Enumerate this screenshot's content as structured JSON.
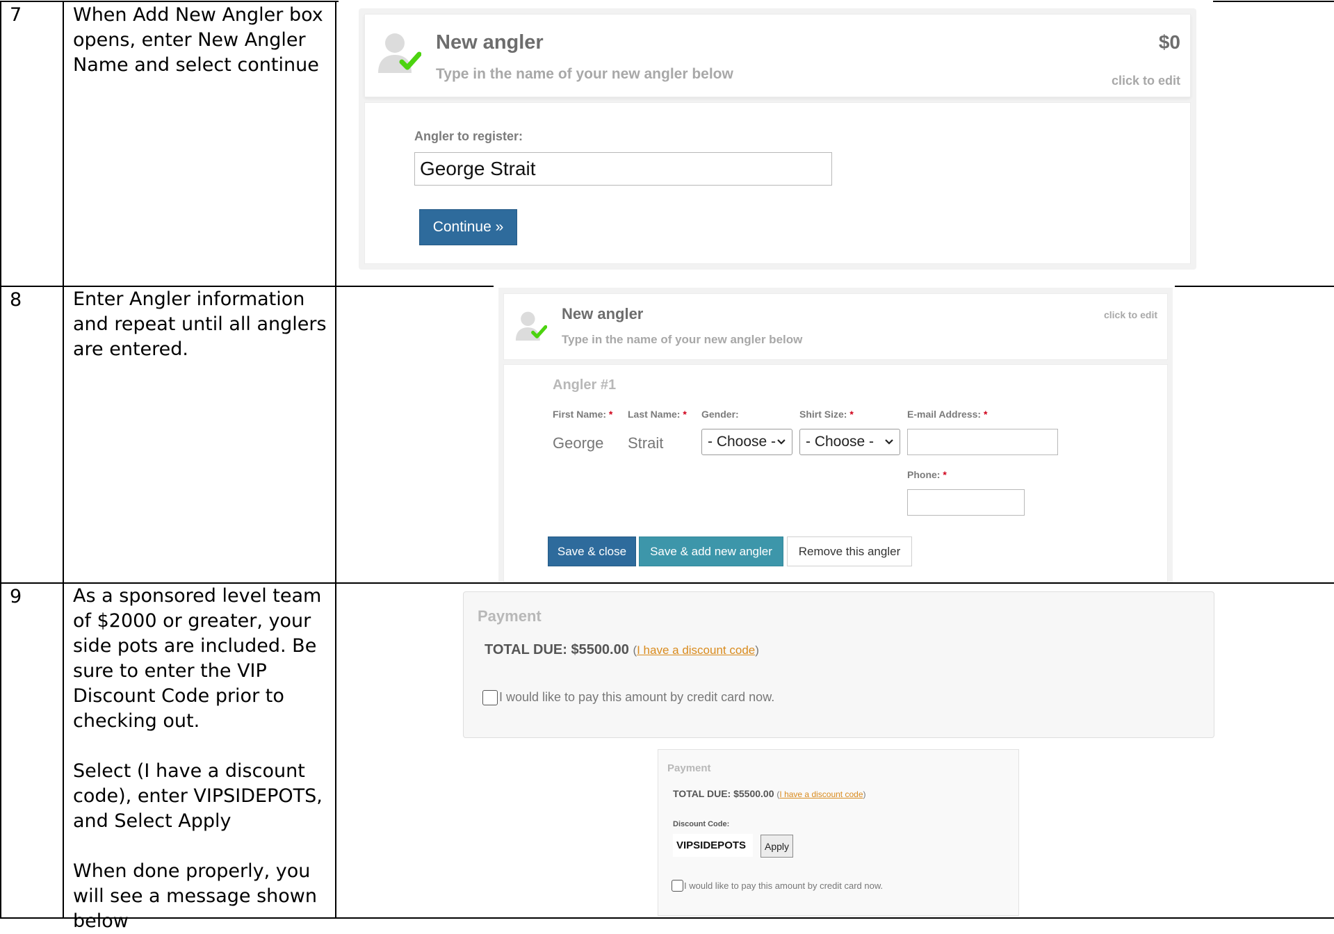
{
  "rows": [
    {
      "number": "7",
      "instruction": [
        "When Add New Angler box opens, enter New Angler Name and select continue"
      ]
    },
    {
      "number": "8",
      "instruction": [
        "Enter Angler information and repeat until all anglers are entered."
      ]
    },
    {
      "number": "9",
      "instruction": [
        "As a sponsored level team of $2000 or greater, your side pots are included. Be sure to enter the VIP Discount Code prior to checking out.",
        "Select (I have a discount code), enter VIPSIDEPOTS, and Select Apply",
        "When done properly, you will see a message shown below"
      ]
    }
  ],
  "panel1": {
    "title": "New angler",
    "subtitle": "Type in the name of your new angler below",
    "price": "$0",
    "edit": "click to edit",
    "field_label": "Angler to register:",
    "field_value": "George Strait",
    "continue_label": "Continue »"
  },
  "panel2": {
    "title": "New angler",
    "subtitle": "Type in the name of your new angler below",
    "edit": "click to edit",
    "section_title": "Angler #1",
    "labels": {
      "first": "First Name:",
      "last": "Last Name:",
      "gender": "Gender:",
      "shirt": "Shirt Size:",
      "email": "E-mail Address:",
      "phone": "Phone:"
    },
    "required_mark": "*",
    "first_value": "George",
    "last_value": "Strait",
    "gender_value": "- Choose -",
    "shirt_value": "- Choose -",
    "buttons": {
      "save_close": "Save & close",
      "save_add": "Save & add new angler",
      "remove": "Remove this angler"
    }
  },
  "payment1": {
    "title": "Payment",
    "total": "TOTAL DUE: $5500.00",
    "open_paren": "(",
    "discount_link": "I have a discount code",
    "close_paren": ")",
    "checkbox_label": "I would like to pay this amount by credit card now."
  },
  "payment2": {
    "title": "Payment",
    "total": "TOTAL DUE: $5500.00",
    "open_paren": "(",
    "discount_link": "I have a discount code",
    "close_paren": ")",
    "code_label": "Discount Code:",
    "code_value": "VIPSIDEPOTS",
    "apply_label": "Apply",
    "checkbox_label": "I would like to pay this amount by credit card now."
  },
  "icons": {
    "avatar": "user-silhouette-icon",
    "check": "green-checkmark-icon",
    "chevron": "chevron-down-icon"
  },
  "colors": {
    "primary_button": "#2e6b9c",
    "secondary_button": "#3d96aa",
    "link": "#d98b1e",
    "required": "#d0021b",
    "check": "#4cd30f"
  }
}
